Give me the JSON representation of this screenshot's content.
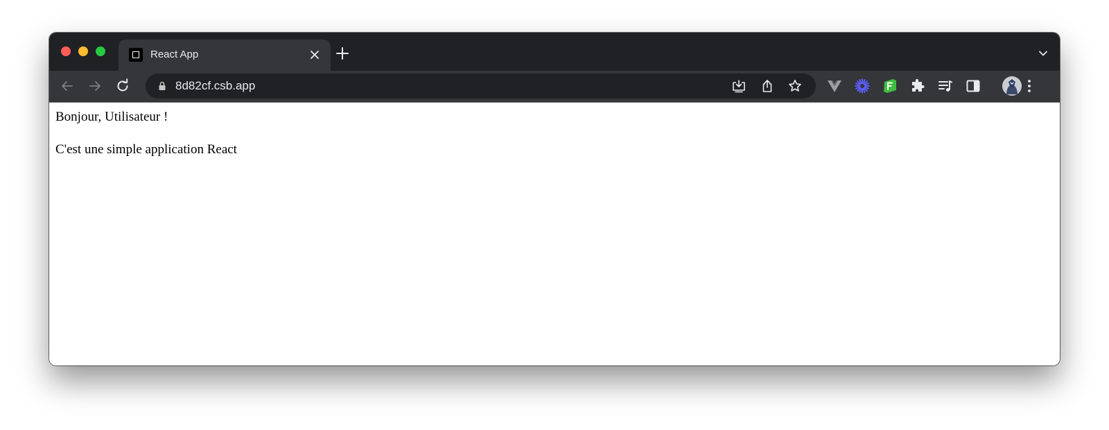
{
  "browser": {
    "tab": {
      "title": "React App",
      "favicon": "square-icon"
    },
    "address_bar": {
      "url": "8d82cf.csb.app"
    },
    "toolbar_icons": [
      "back-arrow-icon",
      "forward-arrow-icon",
      "reload-icon",
      "lock-icon",
      "install-app-icon",
      "share-icon",
      "bookmark-star-icon"
    ],
    "extensions": [
      "vue-devtools-icon",
      "asterisk-extension-icon",
      "green-f-extension-icon",
      "puzzle-extensions-icon",
      "media-playlist-icon",
      "side-panel-icon",
      "profile-avatar",
      "kebab-menu-icon"
    ],
    "colors": {
      "tabstrip": "#202124",
      "toolbar": "#35363a",
      "omnibox": "#202124",
      "traffic_red": "#ff5f57",
      "traffic_yellow": "#febc2e",
      "traffic_green": "#28c840",
      "extension_green": "#3fbf3f",
      "extension_blue": "#5a5cf5"
    }
  },
  "page": {
    "greeting": "Bonjour, Utilisateur !",
    "description": "C'est une simple application React"
  }
}
